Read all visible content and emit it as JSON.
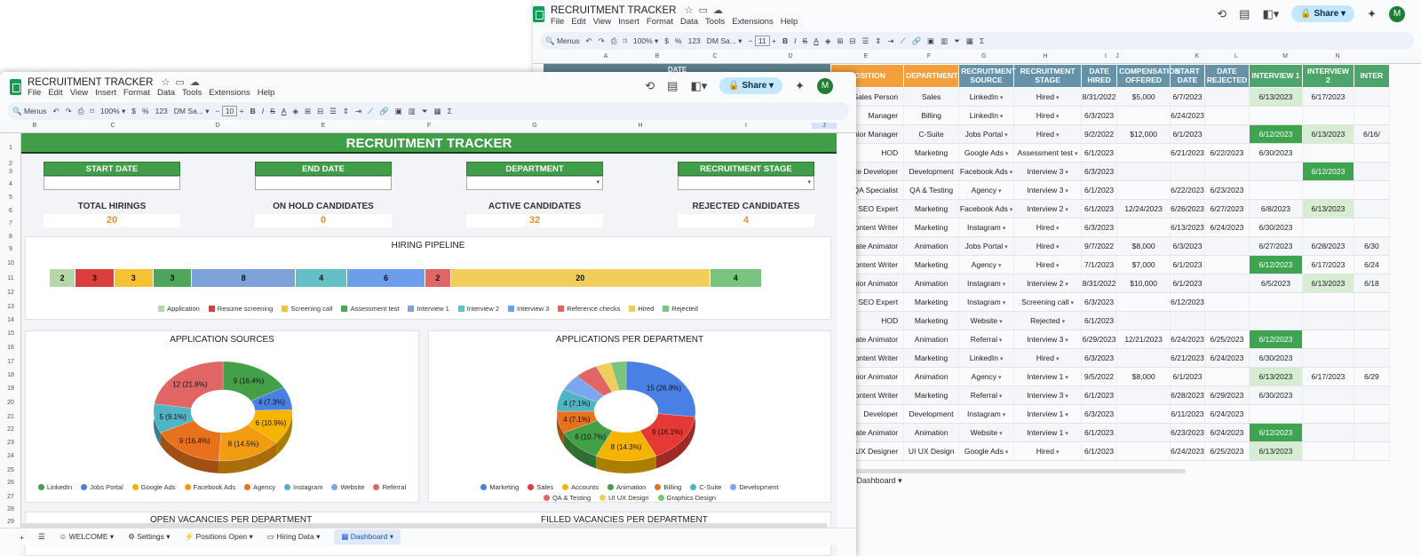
{
  "back": {
    "title": "RECRUITMENT TRACKER",
    "menu": [
      "File",
      "Edit",
      "View",
      "Insert",
      "Format",
      "Data",
      "Tools",
      "Extensions",
      "Help"
    ],
    "share_label": "Share",
    "avatar": "M",
    "toolbar": {
      "search": "Menus",
      "zoom": "100%",
      "currency": "$",
      "percent": "%",
      "fmt123": "123",
      "font": "DM Sa...",
      "size": "11",
      "sigma": "Σ"
    },
    "columns": [
      "A",
      "B",
      "C",
      "D",
      "E",
      "F",
      "G",
      "H",
      "I",
      "J",
      "K",
      "L",
      "M",
      "N"
    ],
    "hidden_header": "DATE",
    "headers": [
      "POSITION",
      "DEPARTMENT",
      "RECRUITMENT SOURCE",
      "RECRUITMENT STAGE",
      "DATE HIRED",
      "COMPENSATION OFFERED",
      "START DATE",
      "DATE REJECTED",
      "INTERVIEW 1",
      "INTERVIEW 2",
      "INTER"
    ],
    "rows": [
      [
        "Sales Person",
        "Sales",
        "LinkedIn",
        "Hired",
        "8/31/2022",
        "$5,000",
        "6/7/2023",
        "",
        "6/13/2023",
        "6/17/2023",
        ""
      ],
      [
        "Manager",
        "Billing",
        "LinkedIn",
        "Hired",
        "6/3/2023",
        "",
        "6/24/2023",
        "",
        "",
        "",
        ""
      ],
      [
        "Senior Manager",
        "C-Suite",
        "Jobs Portal",
        "Hired",
        "9/2/2022",
        "$12,000",
        "6/1/2023",
        "",
        "6/12/2023",
        "6/13/2023",
        "6/16/"
      ],
      [
        "HOD",
        "Marketing",
        "Google Ads",
        "Assessment test",
        "6/1/2023",
        "",
        "6/21/2023",
        "6/22/2023",
        "6/30/2023",
        "",
        ""
      ],
      [
        "ssociate Developer",
        "Development",
        "Facebook Ads",
        "Interview 3",
        "6/3/2023",
        "",
        "",
        "",
        "",
        "6/12/2023",
        ""
      ],
      [
        "QA Specialist",
        "QA & Testing",
        "Agency",
        "Interview 3",
        "6/1/2023",
        "",
        "6/22/2023",
        "6/23/2023",
        "",
        "",
        ""
      ],
      [
        "SEO Expert",
        "Marketing",
        "Facebook Ads",
        "Interview 2",
        "6/1/2023",
        "12/24/2023",
        "6/26/2023",
        "6/27/2023",
        "6/8/2023",
        "6/13/2023",
        ""
      ],
      [
        "Content Writer",
        "Marketing",
        "Instagram",
        "Hired",
        "6/3/2023",
        "",
        "6/13/2023",
        "6/24/2023",
        "6/30/2023",
        "",
        ""
      ],
      [
        "ssociate Animator",
        "Animation",
        "Jobs Portal",
        "Hired",
        "9/7/2022",
        "$8,000",
        "6/3/2023",
        "",
        "6/27/2023",
        "6/28/2023",
        "6/30"
      ],
      [
        "nior Content Writer",
        "Marketing",
        "Agency",
        "Hired",
        "7/1/2023",
        "$7,000",
        "6/1/2023",
        "",
        "6/12/2023",
        "6/17/2023",
        "6/24"
      ],
      [
        "Senior Animator",
        "Animation",
        "Instagram",
        "Interview 2",
        "8/31/2022",
        "$10,000",
        "6/1/2023",
        "",
        "6/5/2023",
        "6/13/2023",
        "6/18"
      ],
      [
        "SEO Expert",
        "Marketing",
        "Instagram",
        "Screening call",
        "6/3/2023",
        "",
        "6/12/2023",
        "",
        "",
        "",
        ""
      ],
      [
        "HOD",
        "Marketing",
        "Website",
        "Rejected",
        "6/1/2023",
        "",
        "",
        "",
        "",
        "",
        ""
      ],
      [
        "ssociate Animator",
        "Animation",
        "Referral",
        "Interview 3",
        "6/29/2023",
        "12/21/2023",
        "6/24/2023",
        "6/25/2023",
        "6/12/2023",
        "",
        ""
      ],
      [
        "nior Content Writer",
        "Marketing",
        "LinkedIn",
        "Hired",
        "6/3/2023",
        "",
        "6/21/2023",
        "6/24/2023",
        "6/30/2023",
        "",
        ""
      ],
      [
        "Senior Animator",
        "Animation",
        "Agency",
        "Interview 1",
        "9/5/2022",
        "$8,000",
        "6/1/2023",
        "",
        "6/13/2023",
        "6/17/2023",
        "6/29"
      ],
      [
        "Content Writer",
        "Marketing",
        "Referral",
        "Interview 3",
        "6/1/2023",
        "",
        "6/28/2023",
        "6/29/2023",
        "6/30/2023",
        "",
        ""
      ],
      [
        "Developer",
        "Development",
        "Instagram",
        "Interview 1",
        "6/3/2023",
        "",
        "6/11/2023",
        "6/24/2023",
        "",
        "",
        ""
      ],
      [
        "ssociate Animator",
        "Animation",
        "Website",
        "Interview 1",
        "6/1/2023",
        "",
        "6/23/2023",
        "6/24/2023",
        "6/12/2023",
        "",
        ""
      ],
      [
        "nior UI UX Designer",
        "UI UX Design",
        "Google Ads",
        "Hired",
        "6/1/2023",
        "",
        "6/24/2023",
        "6/25/2023",
        "6/13/2023",
        "",
        ""
      ]
    ],
    "tab_label": "Dashboard"
  },
  "front": {
    "title": "RECRUITMENT TRACKER",
    "menu": [
      "File",
      "Edit",
      "View",
      "Insert",
      "Format",
      "Data",
      "Tools",
      "Extensions",
      "Help"
    ],
    "share_label": "Share",
    "avatar": "M",
    "toolbar": {
      "search": "Menus",
      "zoom": "100%",
      "currency": "$",
      "percent": "%",
      "fmt123": "123",
      "font": "DM Sa...",
      "size": "10",
      "sigma": "Σ"
    },
    "columns": [
      "B",
      "C",
      "D",
      "E",
      "F",
      "G",
      "H",
      "I",
      "J"
    ],
    "row_numbers": [
      "1",
      "2",
      "3",
      "4",
      "5",
      "6",
      "7",
      "8",
      "9",
      "10",
      "11",
      "12",
      "13",
      "14",
      "15",
      "16",
      "17",
      "18",
      "19",
      "20",
      "21",
      "22",
      "23",
      "24",
      "25",
      "26",
      "27",
      "28",
      "29"
    ],
    "dashboard": {
      "banner": "RECRUITMENT TRACKER",
      "filters": [
        "START DATE",
        "END DATE",
        "DEPARTMENT",
        "RECRUITMENT STAGE"
      ],
      "kpis": [
        {
          "label": "TOTAL HIRINGS",
          "value": "20"
        },
        {
          "label": "ON HOLD CANDIDATES",
          "value": "0"
        },
        {
          "label": "ACTIVE CANDIDATES",
          "value": "32"
        },
        {
          "label": "REJECTED CANDIDATES",
          "value": "4"
        }
      ],
      "pipeline_title": "HIRING PIPELINE",
      "sources_title": "APPLICATION SOURCES",
      "dept_title": "APPLICATIONS PER DEPARTMENT",
      "cut_title_left": "OPEN VACANCIES PER DEPARTMENT",
      "cut_title_right": "FILLED VACANCIES PER DEPARTMENT"
    },
    "tabs": [
      "WELCOME",
      "Settings",
      "Positions Open",
      "Hiring Data",
      "Dashboard"
    ]
  },
  "colors": {
    "green": "#3f9e47",
    "orange": "#f29f3c",
    "steel": "#6592a8",
    "kpi": "#f08c2a"
  },
  "chart_data": [
    {
      "type": "bar",
      "title": "HIRING PIPELINE",
      "categories": [
        "Application",
        "Resume screening",
        "Screening call",
        "Assessment test",
        "Interview 1",
        "Interview 2",
        "Interview 3",
        "Reference checks",
        "Hired",
        "Rejected"
      ],
      "values": [
        2,
        3,
        3,
        3,
        8,
        4,
        6,
        2,
        20,
        4
      ],
      "colors": [
        "#b7d7a8",
        "#dc3e3e",
        "#f4c232",
        "#4ea65a",
        "#7ca2d9",
        "#64bfc6",
        "#6d9eeb",
        "#e06666",
        "#f1cd5a",
        "#7bc47f"
      ],
      "legend": "bottom"
    },
    {
      "type": "pie",
      "title": "APPLICATION SOURCES",
      "categories": [
        "LinkedIn",
        "Jobs Portal",
        "Google Ads",
        "Facebook Ads",
        "Agency",
        "Instagram",
        "Website",
        "Referral"
      ],
      "values": [
        9,
        4,
        6,
        8,
        9,
        5,
        0,
        12
      ],
      "labels": [
        "9 (16.4%)",
        "4 (7.3%)",
        "6 (10.9%)",
        "8 (14.5%)",
        "9 (16.4%)",
        "5 (9.1%)",
        "",
        "12 (21.8%)"
      ],
      "colors": [
        "#43a047",
        "#4a7fe3",
        "#f4b400",
        "#f39c12",
        "#e8711c",
        "#4fb4c4",
        "#7aa7f0",
        "#e06666"
      ],
      "legend": "bottom"
    },
    {
      "type": "pie",
      "title": "APPLICATIONS PER DEPARTMENT",
      "categories": [
        "Marketing",
        "Sales",
        "Accounts",
        "Animation",
        "Billing",
        "C-Suite",
        "Development",
        "QA & Testing",
        "UI UX Design",
        "Graphics Design"
      ],
      "values": [
        15,
        9,
        8,
        6,
        4,
        4,
        3,
        3,
        2,
        2
      ],
      "labels": [
        "15 (26.8%)",
        "9 (16.1%)",
        "8 (14.3%)",
        "6 (10.7%)",
        "4 (7.1%)",
        "4 (7.1%)",
        "",
        "",
        "",
        ""
      ],
      "colors": [
        "#4a7fe3",
        "#e53935",
        "#f4b400",
        "#43a047",
        "#e8711c",
        "#4fb4c4",
        "#7aa7f0",
        "#e06666",
        "#f1cd5a",
        "#7bc47f"
      ],
      "legend": "bottom"
    }
  ]
}
